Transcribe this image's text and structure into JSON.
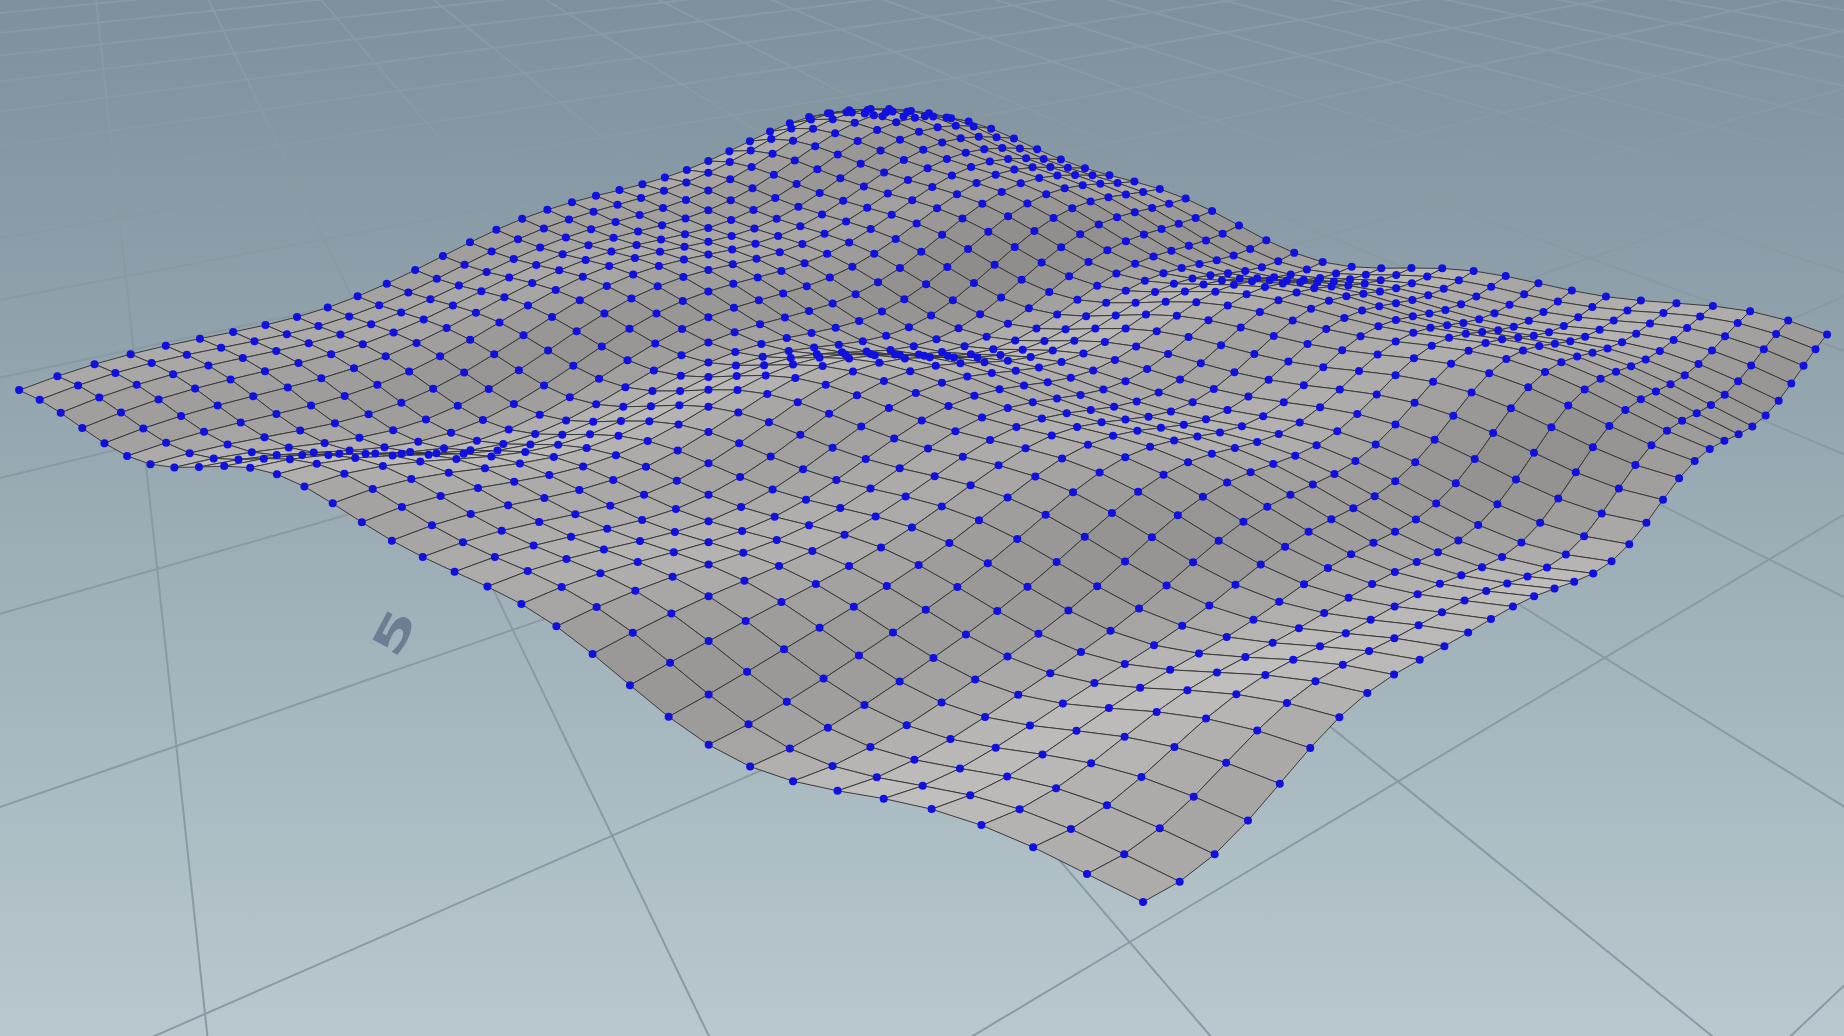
{
  "viewport": {
    "grid_labels": [
      {
        "text": "5"
      }
    ]
  }
}
